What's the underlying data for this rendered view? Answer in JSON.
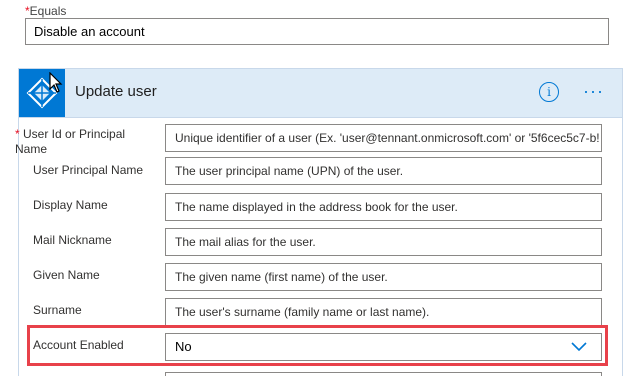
{
  "condition": {
    "required_marker": "*",
    "label": "Equals",
    "value": "Disable an account"
  },
  "action": {
    "title": "Update user",
    "icon": "azure-ad-icon",
    "info_icon": "info-icon",
    "info_glyph": "i",
    "more_icon": "more-options-icon",
    "more_glyph": "···",
    "accent_color": "#0078d4",
    "header_color": "#ddebf7"
  },
  "fields": [
    {
      "required": true,
      "required_marker": "*",
      "label": "User Id or Principal Name",
      "placeholder": "Unique identifier of a user (Ex. 'user@tennant.onmicrosoft.com' or '5f6cec5c7-b!"
    },
    {
      "label": "User Principal Name",
      "placeholder": "The user principal name (UPN) of the user."
    },
    {
      "label": "Display Name",
      "placeholder": "The name displayed in the address book for the user."
    },
    {
      "label": "Mail Nickname",
      "placeholder": "The mail alias for the user."
    },
    {
      "label": "Given Name",
      "placeholder": "The given name (first name) of the user."
    },
    {
      "label": "Surname",
      "placeholder": "The user's surname (family name or last name)."
    },
    {
      "label": "Account Enabled",
      "value": "No",
      "type": "dropdown",
      "icon": "chevron-down-icon",
      "highlight_color": "#e8414a"
    }
  ]
}
